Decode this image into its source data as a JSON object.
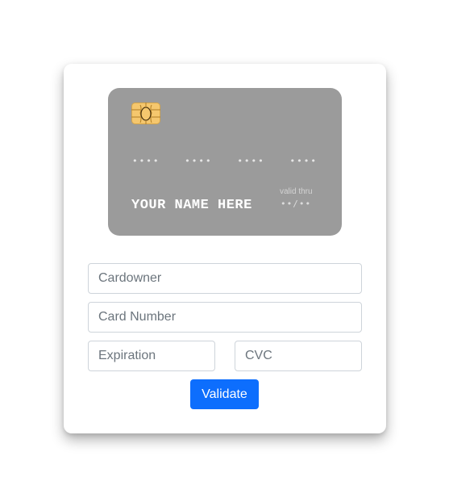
{
  "card_preview": {
    "chip_icon": "chip-icon",
    "number_groups": [
      "••••",
      "••••",
      "••••",
      "••••"
    ],
    "holder_name": "YOUR NAME HERE",
    "valid_label": "valid thru",
    "expiry": "••/••"
  },
  "form": {
    "cardowner_placeholder": "Cardowner",
    "cardowner_value": "",
    "card_number_placeholder": "Card Number",
    "card_number_value": "",
    "expiration_placeholder": "Expiration",
    "expiration_value": "",
    "cvc_placeholder": "CVC",
    "cvc_value": "",
    "submit_label": "Validate"
  },
  "colors": {
    "card_background": "#9b9b9b",
    "chip": "#f5c76e",
    "button": "#0d6efd",
    "border": "#ced4da"
  }
}
